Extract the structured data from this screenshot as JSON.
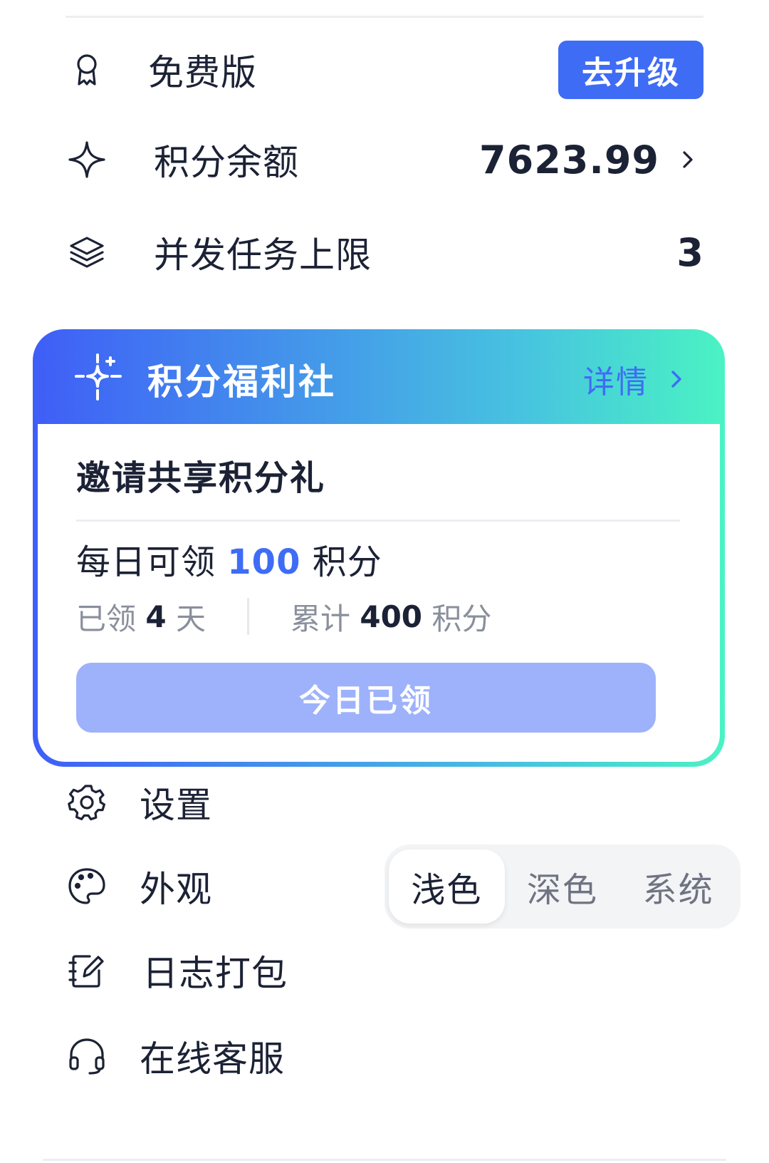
{
  "plan": {
    "label": "免费版",
    "upgrade_label": "去升级"
  },
  "points": {
    "label": "积分余额",
    "value": "7623.99"
  },
  "concurrency": {
    "label": "并发任务上限",
    "value": "3"
  },
  "welfare": {
    "title": "积分福利社",
    "details_label": "详情",
    "task_title": "邀请共享积分礼",
    "daily_prefix": "每日可领",
    "daily_amount": "100",
    "daily_unit": "积分",
    "claimed_prefix": "已领",
    "claimed_days": "4",
    "claimed_unit": "天",
    "total_prefix": "累计",
    "total_points": "400",
    "total_unit": "积分",
    "button_label": "今日已领"
  },
  "menu": {
    "settings_label": "设置",
    "appearance_label": "外观",
    "appearance_options": [
      "浅色",
      "深色",
      "系统"
    ],
    "appearance_selected": "浅色",
    "logs_label": "日志打包",
    "support_label": "在线客服"
  },
  "colors": {
    "accent": "#3f6cf5",
    "text": "#1c2235",
    "muted": "#8a8f9c",
    "gradient_start": "#3f5ef7",
    "gradient_end": "#4af3c3",
    "claimed_button": "#9db2fb"
  },
  "icons": {
    "plan": "award-ribbon-icon",
    "points": "sparkle-star-icon",
    "concurrency": "layers-icon",
    "welfare": "sparkle-crosshair-icon",
    "settings": "gear-icon",
    "appearance": "palette-icon",
    "logs": "notebook-edit-icon",
    "support": "headset-icon"
  }
}
